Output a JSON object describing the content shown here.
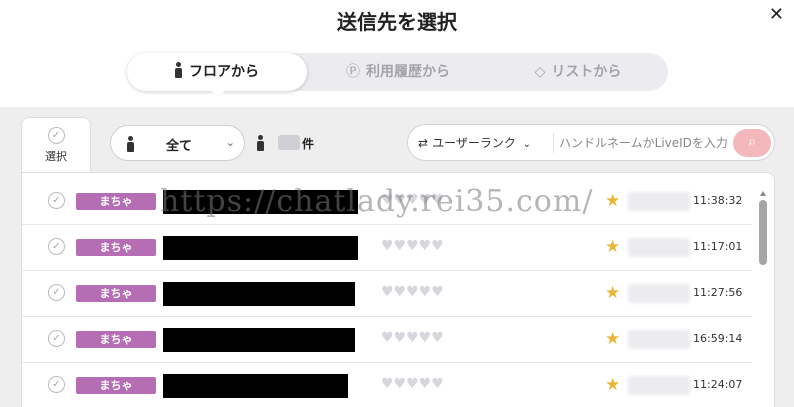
{
  "dialog": {
    "title": "送信先を選択",
    "close_glyph": "✕"
  },
  "tabs": [
    {
      "label": "フロアから",
      "icon": "person-icon",
      "active": true
    },
    {
      "label": "利用履歴から",
      "icon": "p-circle-icon",
      "icon_glyph": "Ⓟ",
      "active": false
    },
    {
      "label": "リストから",
      "icon": "tag-icon",
      "icon_glyph": "◇",
      "active": false
    }
  ],
  "select_all": {
    "label": "選択",
    "check_glyph": "✓"
  },
  "filter": {
    "value": "全て",
    "chevron": "⌄"
  },
  "count": {
    "value": "",
    "unit": "件"
  },
  "search": {
    "rank_label": "ユーザーランク",
    "rank_chevron": "⌄",
    "rank_icon": "sliders-icon",
    "placeholder": "ハンドルネームかLiveIDを入力",
    "button_icon": "search-icon",
    "button_glyph": "⌕"
  },
  "rows": [
    {
      "badge": "まちゃ",
      "hearts": "♥♥♥♥♥",
      "star": "★",
      "time": "11:38:32"
    },
    {
      "badge": "まちゃ",
      "hearts": "♥♥♥♥♥",
      "star": "★",
      "time": "11:17:01"
    },
    {
      "badge": "まちゃ",
      "hearts": "♥♥♥♥♥",
      "star": "★",
      "time": "11:27:56"
    },
    {
      "badge": "まちゃ",
      "hearts": "♥♥♥♥♥",
      "star": "★",
      "time": "16:59:14"
    },
    {
      "badge": "まちゃ",
      "hearts": "♥♥♥♥♥",
      "star": "★",
      "time": "11:24:07"
    }
  ],
  "watermark": "https://chatlady.rei35.com/",
  "colors": {
    "badge": "#b56db3",
    "star": "#e8b73a",
    "search_button": "#f4b8bc",
    "panel": "#eeeeef"
  }
}
